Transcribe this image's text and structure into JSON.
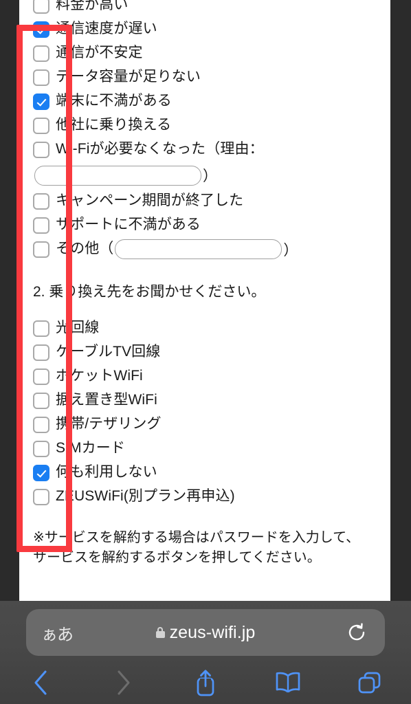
{
  "browser": {
    "text_size_button": "ぁあ",
    "lock_icon": "lock-icon",
    "url": "zeus-wifi.jp",
    "reload_icon": "reload-icon",
    "toolbar": {
      "back_icon": "back-chevron-icon",
      "forward_icon": "forward-chevron-icon",
      "share_icon": "share-icon",
      "bookmarks_icon": "book-icon",
      "tabs_icon": "tabs-icon"
    }
  },
  "page": {
    "question1_options": [
      {
        "label": "料金が高い",
        "checked": false
      },
      {
        "label": "通信速度が遅い",
        "checked": true
      },
      {
        "label": "通信が不安定",
        "checked": false
      },
      {
        "label": "データ容量が足りない",
        "checked": false
      },
      {
        "label": "端末に不満がある",
        "checked": true
      },
      {
        "label": "他社に乗り換える",
        "checked": false
      }
    ],
    "wifi_reason": {
      "label": "Wi-Fiが必要なくなった（理由：",
      "input_value": "",
      "close_paren": "）",
      "checked": false
    },
    "question1_options_tail": [
      {
        "label": "キャンペーン期間が終了した",
        "checked": false
      },
      {
        "label": "サポートに不満がある",
        "checked": false
      }
    ],
    "other_option": {
      "label": "その他（",
      "input_value": "",
      "close_paren": "）",
      "checked": false
    },
    "question2_title": "2. 乗り換え先をお聞かせください。",
    "question2_options": [
      {
        "label": "光回線",
        "checked": false
      },
      {
        "label": "ケーブルTV回線",
        "checked": false
      },
      {
        "label": "ポケットWiFi",
        "checked": false
      },
      {
        "label": "据え置き型WiFi",
        "checked": false
      },
      {
        "label": "携帯/テザリング",
        "checked": false
      },
      {
        "label": "SIMカード",
        "checked": false
      },
      {
        "label": "何も利用しない",
        "checked": true
      },
      {
        "label": "ZEUSWiFi(別プラン再申込)",
        "checked": false
      }
    ],
    "footer_note_line1": "※サービスを解約する場合はパスワードを入力して、",
    "footer_note_line2": "サービスを解約するボタンを押してください。"
  },
  "annotation": {
    "shape": "rectangle",
    "color": "#f93a3f"
  }
}
